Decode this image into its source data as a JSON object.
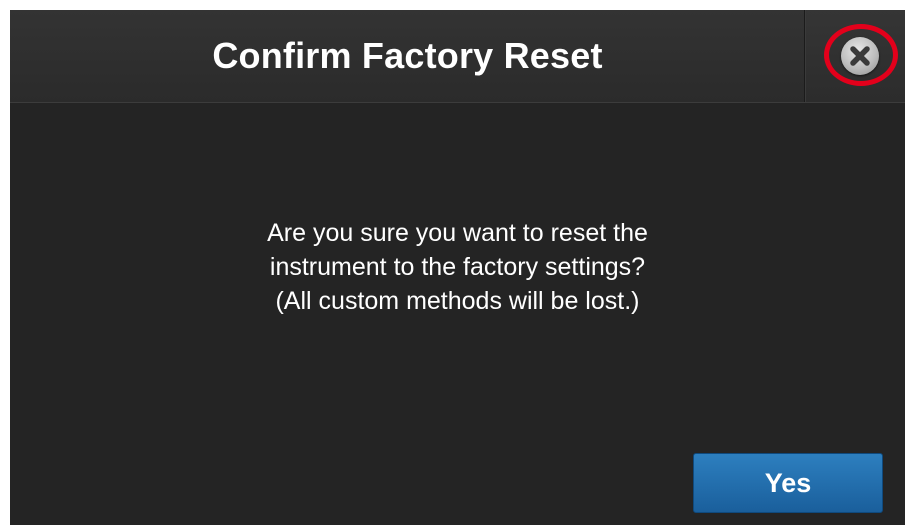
{
  "dialog": {
    "title": "Confirm Factory Reset",
    "message_lines": [
      "Are you sure you want to reset the",
      "instrument to the factory settings?",
      "(All custom methods will be lost.)"
    ],
    "confirm_label": "Yes",
    "close_icon": "close-icon",
    "close_highlight_color": "#e3001b",
    "confirm_button_color": "#1f6aa8",
    "background_color": "#242424"
  }
}
